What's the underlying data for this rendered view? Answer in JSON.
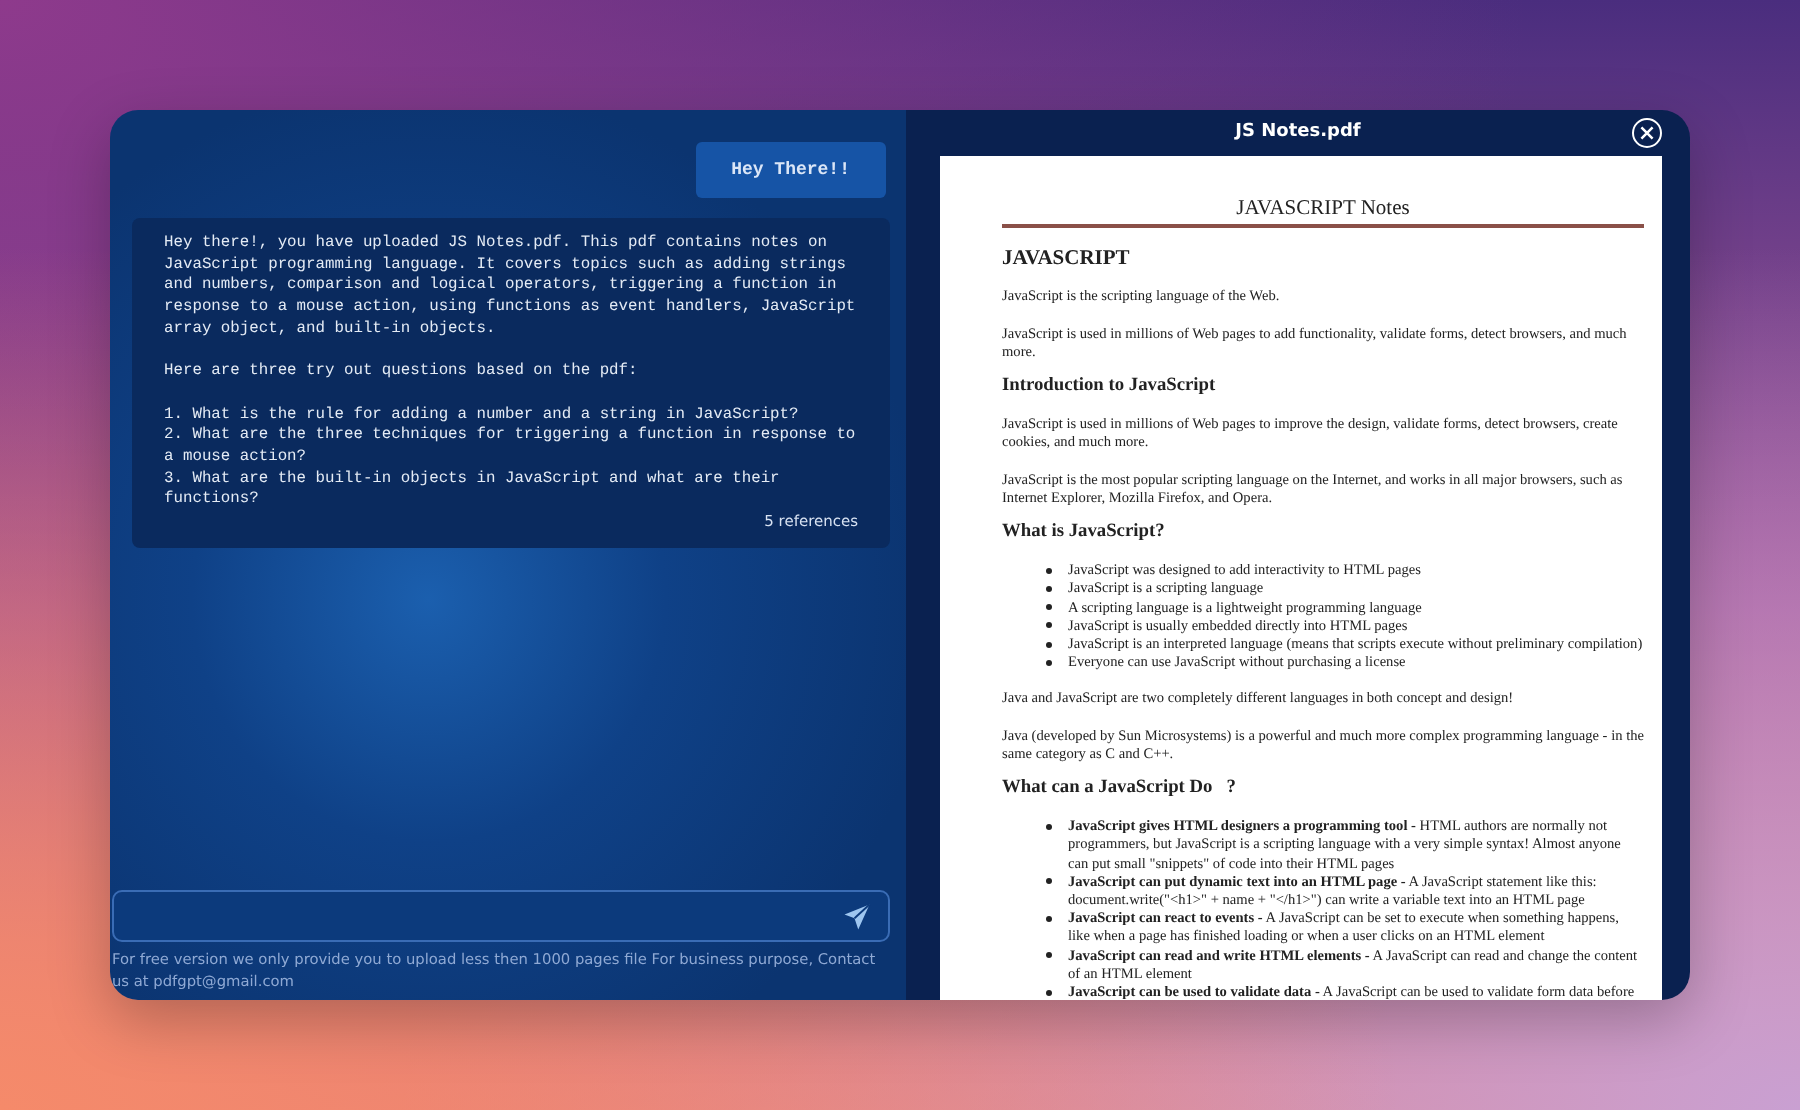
{
  "chat": {
    "messages": [
      {
        "kind": "user",
        "text": "Hey There!!"
      },
      {
        "kind": "assistant",
        "paragraphs": [
          "Hey there!, you have uploaded JS Notes.pdf. This pdf contains notes on JavaScript programming language. It covers topics such as adding strings and numbers, comparison and logical operators, triggering a function in response to a mouse action, using functions as event handlers, JavaScript array object, and built-in objects.",
          "Here are three try out questions based on the pdf:"
        ],
        "questions": [
          "1. What is the rule for adding a number and a string in JavaScript?",
          "2. What are the three techniques for triggering a function in response to a mouse action?",
          "3. What are the built-in objects in JavaScript and what are their functions?"
        ],
        "references": "5 references"
      }
    ],
    "notice": "For free version we only provide you to upload less then 1000 pages file For business purpose, Contact us at pdfgpt@gmail.com"
  },
  "viewer": {
    "title": "JS Notes.pdf",
    "document": {
      "title": "JAVASCRIPT Notes",
      "blocks": [
        {
          "kind": "main_heading",
          "text": "JAVASCRIPT"
        },
        {
          "kind": "paragraph",
          "text": "JavaScript is the scripting language of the Web."
        },
        {
          "kind": "paragraph",
          "text": "JavaScript is used in millions of Web pages to add functionality, validate forms, detect browsers, and much more."
        },
        {
          "kind": "heading",
          "text": "Introduction to JavaScript"
        },
        {
          "kind": "paragraph",
          "text": "JavaScript is used in millions of Web pages to improve the design, validate forms, detect browsers, create cookies, and much more."
        },
        {
          "kind": "paragraph",
          "text": "JavaScript is the most popular scripting language on the Internet, and works in all major browsers, such as Internet Explorer, Mozilla Firefox, and Opera."
        },
        {
          "kind": "heading",
          "text": "What is JavaScript?"
        },
        {
          "kind": "list",
          "items": [
            "JavaScript was designed to add interactivity to HTML pages",
            "JavaScript is a scripting language",
            "A scripting language is a lightweight programming language",
            "JavaScript is usually embedded directly into HTML pages",
            "JavaScript is an interpreted language (means that scripts execute without preliminary compilation)",
            "Everyone can use JavaScript without purchasing a license"
          ]
        },
        {
          "kind": "paragraph",
          "text": "Java and JavaScript are two completely different languages in both concept and design!"
        },
        {
          "kind": "paragraph",
          "text": "Java (developed by Sun Microsystems) is a powerful and much more complex programming language - in the same category as C and C++."
        },
        {
          "kind": "heading",
          "text": "What can a JavaScript Do   ?"
        },
        {
          "kind": "list",
          "items": [
            "**JavaScript gives HTML designers a programming tool -** HTML authors are normally not programmers, but JavaScript is a scripting language with a very simple syntax! Almost anyone can put small \"snippets\" of code into their HTML pages",
            "**JavaScript can put dynamic text into an HTML page -** A JavaScript statement like this: document.write(\"<h1>\" + name + \"</h1>\") can write a variable text into an HTML page",
            "**JavaScript can react to events -** A JavaScript can be set to execute when something happens, like when a page has finished loading or when a user clicks on an HTML element",
            "**JavaScript can read and write HTML elements -** A JavaScript can read and change the content of an HTML element",
            "**JavaScript can be used to validate data -** A JavaScript can be used to validate form data before"
          ]
        }
      ]
    }
  }
}
